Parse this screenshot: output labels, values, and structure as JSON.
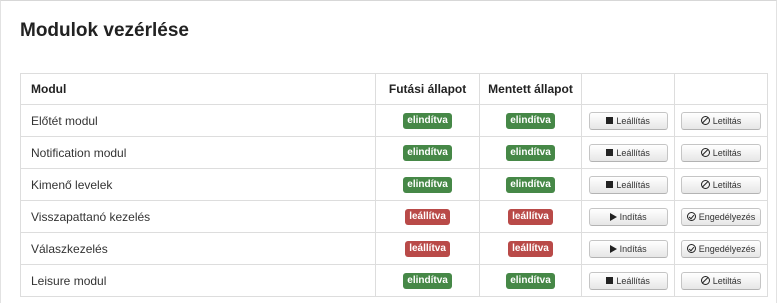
{
  "title": "Modulok vezérlése",
  "headers": {
    "module": "Modul",
    "run_state": "Futási állapot",
    "saved_state": "Mentett állapot"
  },
  "rows": [
    {
      "name": "Előtét modul",
      "run": "elindítva",
      "saved": "elindítva",
      "action": "Leállítás",
      "toggle": "Letiltás"
    },
    {
      "name": "Notification modul",
      "run": "elindítva",
      "saved": "elindítva",
      "action": "Leállítás",
      "toggle": "Letiltás"
    },
    {
      "name": "Kimenő levelek",
      "run": "elindítva",
      "saved": "elindítva",
      "action": "Leállítás",
      "toggle": "Letiltás"
    },
    {
      "name": "Visszapattanó kezelés",
      "run": "leállítva",
      "saved": "leállítva",
      "action": "Indítás",
      "toggle": "Engedélyezés"
    },
    {
      "name": "Válaszkezelés",
      "run": "leállítva",
      "saved": "leállítva",
      "action": "Indítás",
      "toggle": "Engedélyezés"
    },
    {
      "name": "Leisure modul",
      "run": "elindítva",
      "saved": "elindítva",
      "action": "Leállítás",
      "toggle": "Letiltás"
    }
  ],
  "icons": {
    "stop": "stop-icon",
    "play": "play-icon",
    "disable": "ban-icon",
    "enable": "check-circle-icon"
  },
  "colors": {
    "running": "#468847",
    "stopped": "#b94a48"
  }
}
